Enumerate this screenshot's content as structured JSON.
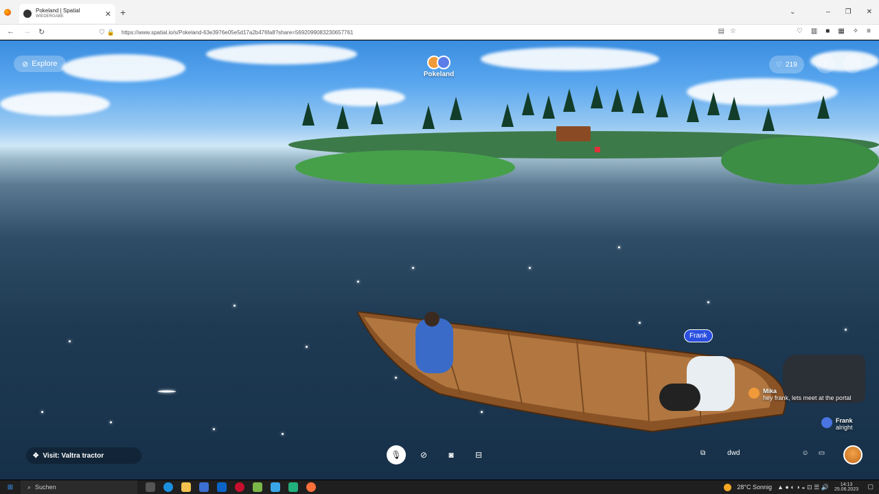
{
  "browser": {
    "tab_title": "Pokeland | Spatial",
    "tab_subtitle": "WIEDERGABE",
    "new_tab_icon": "plus-icon",
    "url": "https://www.spatial.io/s/Pokeland-63e3976e05e5d17a2b476fa8?share=5692099083230657761"
  },
  "world": {
    "explore_label": "Explore",
    "title": "Pokeland",
    "likes": "219"
  },
  "scene": {
    "nametag": "Frank",
    "chat": [
      {
        "name": "Mika",
        "text": "hey frank, lets meet at the portal"
      },
      {
        "name": "Frank",
        "text": "alright"
      }
    ]
  },
  "controls": {
    "visit_label": "Visit: Valtra tractor",
    "room_label": "dwd"
  },
  "taskbar": {
    "search_placeholder": "Suchen",
    "weather": "28°C Sonnig",
    "time": "14:13",
    "date": "25.06.2023"
  },
  "colors": {
    "nametag": "#2b4fe0",
    "water": "#1e3a52",
    "sky": "#5aa7ef"
  }
}
